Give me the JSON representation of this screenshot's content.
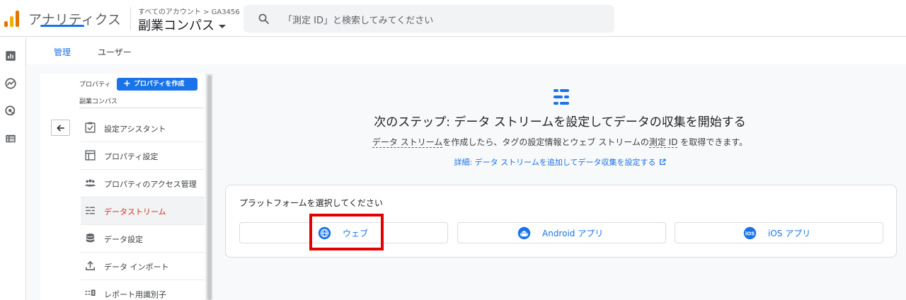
{
  "header": {
    "app_name": "アナリティクス",
    "account_breadcrumb": "すべてのアカウント > GA3456",
    "property_name": "副業コンパス",
    "search_placeholder": "「測定 ID」と検索してみてください"
  },
  "tabs": [
    {
      "label": "管理",
      "active": true
    },
    {
      "label": "ユーザー",
      "active": false
    }
  ],
  "panel": {
    "property_label": "プロパティ",
    "create_button": "プロパティを作成",
    "property_name": "副業コンパス",
    "items": [
      {
        "label": "設定アシスタント",
        "icon": "checkbox-icon",
        "active": false
      },
      {
        "label": "プロパティ設定",
        "icon": "layout-icon",
        "active": false
      },
      {
        "label": "プロパティのアクセス管理",
        "icon": "people-icon",
        "active": false
      },
      {
        "label": "データストリーム",
        "icon": "streams-icon",
        "active": true
      },
      {
        "label": "データ設定",
        "icon": "database-icon",
        "active": false
      },
      {
        "label": "データ インポート",
        "icon": "upload-icon",
        "active": false
      },
      {
        "label": "レポート用識別子",
        "icon": "identifier-icon",
        "active": false
      }
    ]
  },
  "main": {
    "title": "次のステップ: データ ストリームを設定してデータの収集を開始する",
    "desc_term1": "データ ストリーム",
    "desc_mid": "を作成したら、タグの設定情報とウェブ ストリームの",
    "desc_term2": "測定 ID",
    "desc_end": " を取得できます。",
    "learn_link": "詳細: データ ストリームを追加してデータ収集を設定する",
    "platform_label": "プラットフォームを選択してください",
    "platforms": [
      {
        "label": "ウェブ",
        "icon": "globe-icon"
      },
      {
        "label": "Android アプリ",
        "icon": "android-icon"
      },
      {
        "label": "iOS アプリ",
        "icon": "ios-icon"
      }
    ]
  },
  "colors": {
    "accent": "#1a73e8",
    "active_item": "#d93025",
    "highlight": "#e50000",
    "logo": [
      "#f9ab00",
      "#e37400"
    ]
  }
}
